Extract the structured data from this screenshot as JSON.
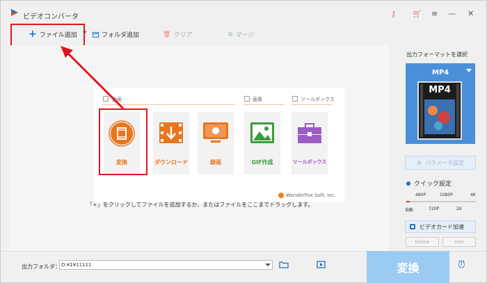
{
  "window": {
    "title": "ビデオコンバータ"
  },
  "toolbar": {
    "add_file": "ファイル追加",
    "add_folder": "フォルダ追加",
    "clear": "クリア",
    "merge": "マージ"
  },
  "card": {
    "sections": {
      "video": "動画",
      "image": "画像",
      "toolbox": "ツールボックス"
    },
    "tiles": [
      {
        "label": "変換",
        "color": "#e8761e",
        "icon": "film-convert-icon"
      },
      {
        "label": "ダウンロード",
        "color": "#e8761e",
        "icon": "download-icon"
      },
      {
        "label": "録画",
        "color": "#e8761e",
        "icon": "screen-record-icon"
      },
      {
        "label": "GIF作成",
        "color": "#3c9a3c",
        "icon": "image-icon"
      },
      {
        "label": "ツールボックス",
        "color": "#9d5bc4",
        "icon": "toolbox-icon"
      }
    ],
    "watermark": "WonderFox Soft, Inc."
  },
  "hint": "「+」をクリックしてファイルを追加するか、またはファイルをここまでドラッグします。",
  "panel": {
    "title": "出力フォーマットを選択",
    "format": "MP4",
    "format_image_text": "MP4",
    "param_button": "パラメータ設定",
    "quick_setting": "クイック設定",
    "resolutions_top": [
      "480P",
      "1080P",
      "4K"
    ],
    "resolutions_bottom": [
      "自動",
      "720P",
      "2K"
    ],
    "quality_fraction": 0,
    "hw_accel": "ビデオカード加速",
    "gpu_chips": [
      "NVIDIA",
      "Intel"
    ]
  },
  "bottom": {
    "output_label": "出力フォルダ：",
    "output_path": "D:¥1¥11111",
    "convert": "変換"
  },
  "colors": {
    "accent": "#1e72c8",
    "highlight": "#e0161e",
    "orange": "#e8761e",
    "convert_bg": "#9ccbf2"
  }
}
